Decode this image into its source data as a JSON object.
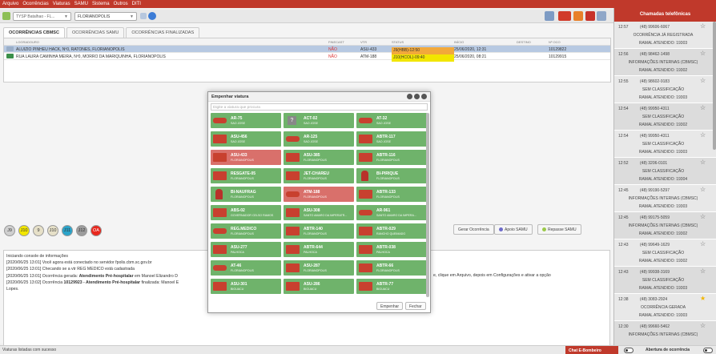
{
  "menu": [
    "Arquivo",
    "Ocorrências",
    "Viaturas",
    "SAMU",
    "Sistema",
    "Outros",
    "DITI"
  ],
  "toolbar": {
    "combo1_placeholder": "TYSP Batalhao - FL...",
    "combo2_value": "FLORIANOPOLIS"
  },
  "tabs": [
    "OCORRÊNCIAS CBMSC",
    "OCORRÊNCIAS SAMU",
    "OCORRÊNCIAS FINALIZADAS"
  ],
  "grid": {
    "headers": [
      "LOGRADOURO",
      "FINECAST",
      "VTR",
      "STATUS",
      "INÍCIO",
      "DESTINO",
      "Nº OCO"
    ],
    "rows": [
      {
        "logradouro": "ALUIZIO PINHEU HACK, Nº0, RATONES, FLORIANOPOLIS",
        "finecast": "NÃO",
        "vtr": "ASU-433",
        "status": "J9(HBB)-12:50",
        "inicio": "25/06/2020, 12:31",
        "destino": "",
        "numero": "10129822"
      },
      {
        "logradouro": "RUA LAURA CAMINHA MEIRA, Nº0, MORRO DA MARIQUINHA, FLORIANOPOLIS",
        "finecast": "NÃO",
        "vtr": "ATM-188",
        "status": "J10(HCOL)-09:40",
        "inicio": "25/06/2020, 08:21",
        "destino": "",
        "numero": "10129915"
      }
    ]
  },
  "circles": [
    {
      "label": "J9",
      "color": "#cfcfcf"
    },
    {
      "label": "J10",
      "color": "#f2e600"
    },
    {
      "label": "9",
      "color": "#e6e0c8"
    },
    {
      "label": "J10",
      "color": "#e6e0c8"
    },
    {
      "label": "J11",
      "color": "#2aa3c9"
    },
    {
      "label": "J12",
      "color": "#9c9c9c"
    },
    {
      "label": "OA",
      "color": "#e8281e"
    }
  ],
  "buttons": {
    "gerar": "Gerar Ocorrência",
    "apoio": "Apoio SAMU",
    "repasse": "Repasse SAMU"
  },
  "console": {
    "lines": [
      {
        "prefix": "Iniciando console de informações",
        "bold": "",
        "suffix": ""
      },
      {
        "prefix": "[2020/06/25 13:01] Você agora está conectado no servidor fpolis.cbm.sc.gov.br",
        "bold": "",
        "suffix": ""
      },
      {
        "prefix": "[2020/06/25 13:01] Checando se a vtr REG MEDICO está cadastrada",
        "bold": "",
        "suffix": ""
      },
      {
        "prefix": "[2020/06/25 13:01] Ocorrência gerada: ",
        "bold": "Atendimento Pré-hospitalar",
        "suffix": " em Manoel Elizandro D"
      },
      {
        "prefix": "[2020/06/25 13:02] Ocorrência ",
        "bold": "10129923 - Atendimento Pré-hospitalar",
        "suffix": " finalizada: Manoel E"
      },
      {
        "prefix": "Lopes.",
        "bold": "",
        "suffix": ""
      }
    ],
    "right_fragment": "e, clique em Arquivo, depois em Configurações e ativar a opção"
  },
  "status_text": "Viaturas listadas com sucesso",
  "chat_label": "Chat E-Bombeiro",
  "abertura_label": "Abertura de ocorrência",
  "calls_title": "Chamadas telefônicas",
  "calls": [
    {
      "time": "12:57",
      "phone": "(48) 99606-6067",
      "status": "OCORRÊNCIA JÁ REGISTRADA",
      "ramal": "RAMAL ATENDIDO: 19303",
      "fav": false
    },
    {
      "time": "12:56",
      "phone": "(48) 98462-1498",
      "status": "INFORMAÇÕES INTERNAS (CBMSC)",
      "ramal": "RAMAL ATENDIDO: 19302",
      "fav": false
    },
    {
      "time": "12:55",
      "phone": "(48) 98602-9183",
      "status": "SEM CLASSIFICAÇÃO",
      "ramal": "RAMAL ATENDIDO: 19303",
      "fav": false
    },
    {
      "time": "12:54",
      "phone": "(48) 99950-4311",
      "status": "SEM CLASSIFICAÇÃO",
      "ramal": "RAMAL ATENDIDO: 19302",
      "fav": false
    },
    {
      "time": "12:54",
      "phone": "(48) 99950-4311",
      "status": "SEM CLASSIFICAÇÃO",
      "ramal": "RAMAL ATENDIDO: 19303",
      "fav": false
    },
    {
      "time": "12:52",
      "phone": "(48) 3206-0101",
      "status": "SEM CLASSIFICAÇÃO",
      "ramal": "RAMAL ATENDIDO: 19304",
      "fav": false
    },
    {
      "time": "12:45",
      "phone": "(48) 99190-5297",
      "status": "INFORMAÇÕES INTERNAS (CBMSC)",
      "ramal": "RAMAL ATENDIDO: 19303",
      "fav": false
    },
    {
      "time": "12:45",
      "phone": "(48) 99175-5059",
      "status": "INFORMAÇÕES INTERNAS (CBMSC)",
      "ramal": "RAMAL ATENDIDO: 19302",
      "fav": false
    },
    {
      "time": "12:43",
      "phone": "(48) 99649-1629",
      "status": "SEM CLASSIFICAÇÃO",
      "ramal": "RAMAL ATENDIDO: 19302",
      "fav": false
    },
    {
      "time": "12:43",
      "phone": "(48) 99938-3169",
      "status": "SEM CLASSIFICAÇÃO",
      "ramal": "RAMAL ATENDIDO: 19303",
      "fav": false
    },
    {
      "time": "12:38",
      "phone": "(48) 3083-2924",
      "status": "OCORRÊNCIA GERADA",
      "ramal": "RAMAL ATENDIDO: 19303",
      "fav": true
    },
    {
      "time": "12:30",
      "phone": "(48) 99660-5462",
      "status": "INFORMAÇÕES INTERNAS (CBMSC)",
      "ramal": "",
      "fav": false
    }
  ],
  "dialog": {
    "title": "Empenhar viatura",
    "search_placeholder": "Digite a viatura que procura",
    "confirm": "Empenhar",
    "cancel": "Fechar",
    "vehicles": [
      {
        "code": "AR-75",
        "loc": "SAO JOSE",
        "color": "#6fb36b",
        "kind": "car"
      },
      {
        "code": "ACT-02",
        "loc": "SAO JOSE",
        "color": "#6fb36b",
        "kind": "unknown"
      },
      {
        "code": "AT-32",
        "loc": "SAO JOSE",
        "color": "#6fb36b",
        "kind": "car"
      },
      {
        "code": "ASU-456",
        "loc": "SAO JOSE",
        "color": "#6fb36b",
        "kind": "truck"
      },
      {
        "code": "AR-125",
        "loc": "SAO JOSE",
        "color": "#6fb36b",
        "kind": "car"
      },
      {
        "code": "ABTR-117",
        "loc": "SAO JOSE",
        "color": "#6fb36b",
        "kind": "truck"
      },
      {
        "code": "ASU-433",
        "loc": "FLORIANOPOLIS",
        "color": "#d9706b",
        "kind": "truck"
      },
      {
        "code": "ASU-385",
        "loc": "FLORIANOPOLIS",
        "color": "#6fb36b",
        "kind": "truck"
      },
      {
        "code": "ABTR-116",
        "loc": "FLORIANOPOLIS",
        "color": "#6fb36b",
        "kind": "truck"
      },
      {
        "code": "RESGATE-05",
        "loc": "FLORIANOPOLIS",
        "color": "#6fb36b",
        "kind": "truck"
      },
      {
        "code": "JET-CHAREU",
        "loc": "FLORIANOPOLIS",
        "color": "#6fb36b",
        "kind": "truck"
      },
      {
        "code": "BI-PIRIQUE",
        "loc": "FLORIANOPOLIS",
        "color": "#6fb36b",
        "kind": "person"
      },
      {
        "code": "BI-NAUFRAG",
        "loc": "FLORIANOPOLIS",
        "color": "#6fb36b",
        "kind": "person"
      },
      {
        "code": "ATM-188",
        "loc": "FLORIANOPOLIS",
        "color": "#d9706b",
        "kind": "car"
      },
      {
        "code": "ABTR-133",
        "loc": "FLORIANOPOLIS",
        "color": "#6fb36b",
        "kind": "truck"
      },
      {
        "code": "ABS-02",
        "loc": "GOVERNADOR CELSO RAMOS",
        "color": "#6fb36b",
        "kind": "truck"
      },
      {
        "code": "ASU-308",
        "loc": "SANTO AMARO DA IMPERATR...",
        "color": "#6fb36b",
        "kind": "truck"
      },
      {
        "code": "AR-961",
        "loc": "SANTO AMARO DA IMPERA...",
        "color": "#6fb36b",
        "kind": "car"
      },
      {
        "code": "REG.MEDICO",
        "loc": "FLORIANOPOLIS",
        "color": "#6fb36b",
        "kind": "car"
      },
      {
        "code": "ABTR-140",
        "loc": "FLORIANOPOLIS",
        "color": "#6fb36b",
        "kind": "truck"
      },
      {
        "code": "ABTR-029",
        "loc": "RANCHO QUEIMADO",
        "color": "#6fb36b",
        "kind": "truck"
      },
      {
        "code": "ASU-277",
        "loc": "PALHOCA",
        "color": "#6fb36b",
        "kind": "truck"
      },
      {
        "code": "ABTR-644",
        "loc": "PALHOCA",
        "color": "#6fb36b",
        "kind": "truck"
      },
      {
        "code": "ABTR-038",
        "loc": "PALHOCA",
        "color": "#6fb36b",
        "kind": "truck"
      },
      {
        "code": "AT-46",
        "loc": "FLORIANOPOLIS",
        "color": "#6fb36b",
        "kind": "car"
      },
      {
        "code": "ASU-287",
        "loc": "FLORIANOPOLIS",
        "color": "#6fb36b",
        "kind": "truck"
      },
      {
        "code": "ABTR-66",
        "loc": "FLORIANOPOLIS",
        "color": "#6fb36b",
        "kind": "truck"
      },
      {
        "code": "ASU-301",
        "loc": "BIGUACU",
        "color": "#6fb36b",
        "kind": "truck"
      },
      {
        "code": "ASU-286",
        "loc": "BIGUACU",
        "color": "#6fb36b",
        "kind": "truck"
      },
      {
        "code": "ABTR-77",
        "loc": "BIGUACU",
        "color": "#6fb36b",
        "kind": "truck"
      }
    ]
  }
}
